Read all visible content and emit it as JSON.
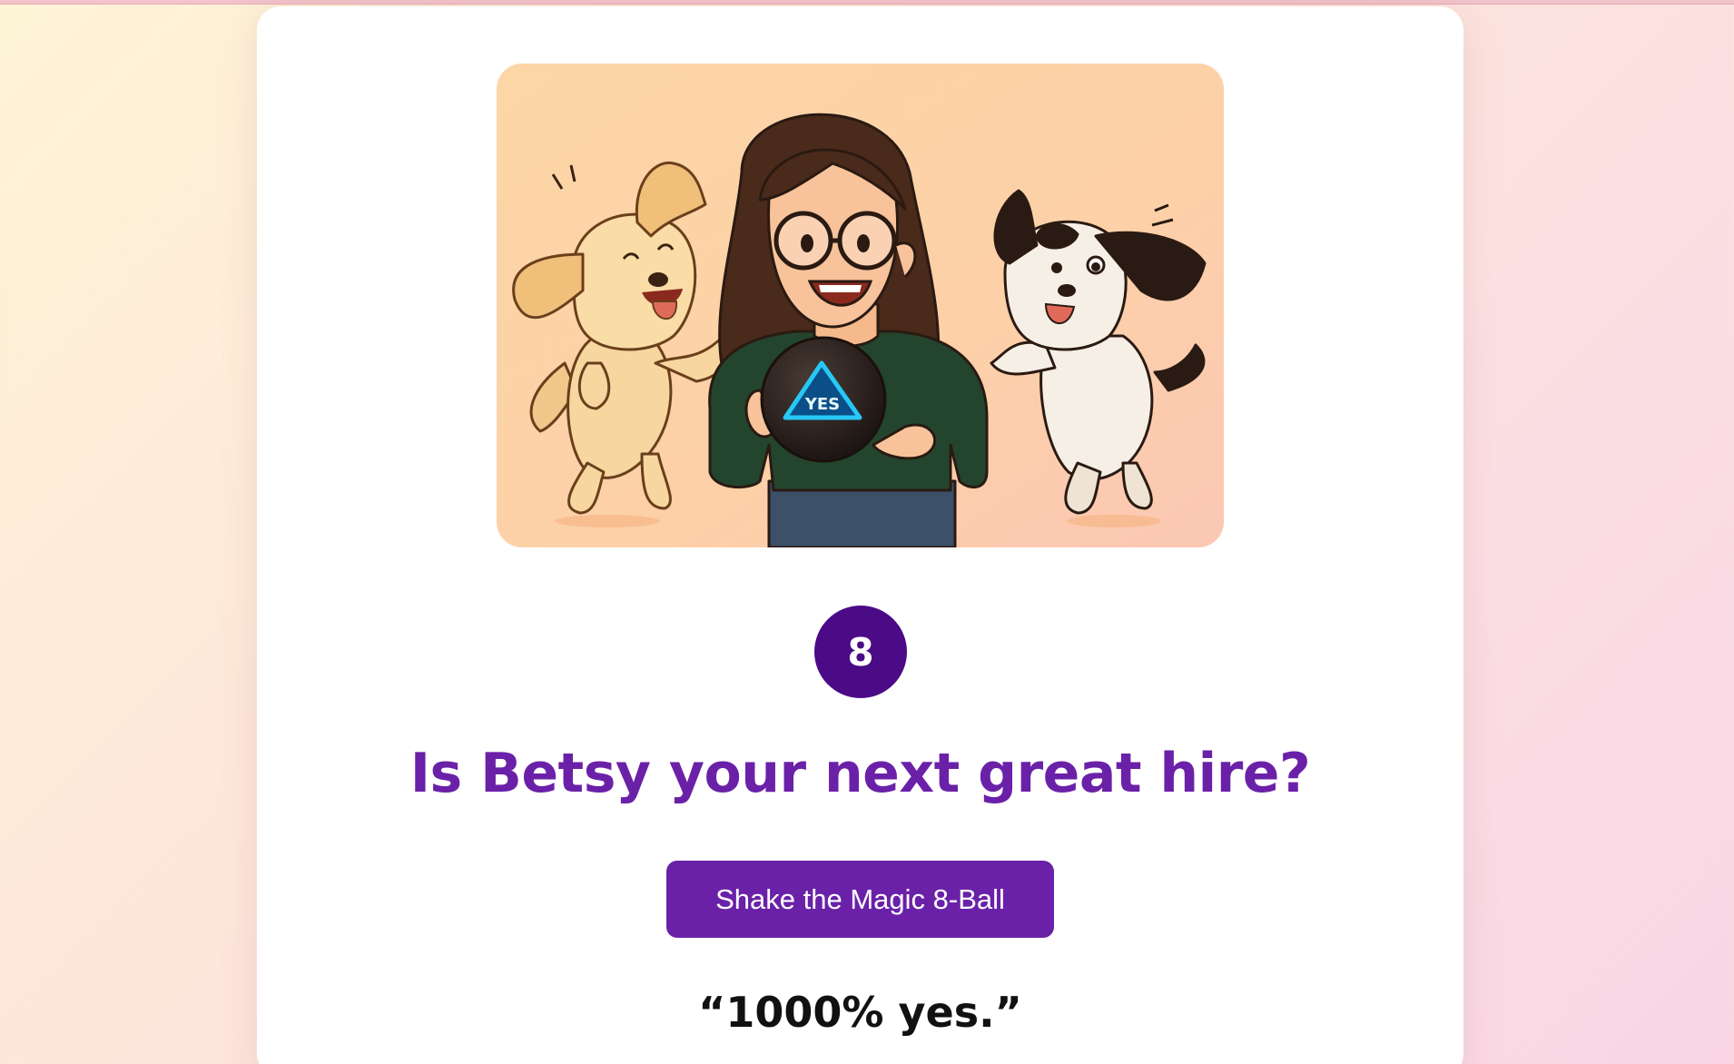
{
  "colors": {
    "accent": "#6a21a8",
    "badge": "#4b0a86",
    "ball_glow": "#27c8f5"
  },
  "hero": {
    "ball_text": "YES",
    "icon": "betsy-with-dogs-illustration"
  },
  "badge": {
    "label": "8"
  },
  "headline": "Is Betsy your next great hire?",
  "button": {
    "label": "Shake the Magic 8-Ball"
  },
  "answer": "“1000% yes.”"
}
